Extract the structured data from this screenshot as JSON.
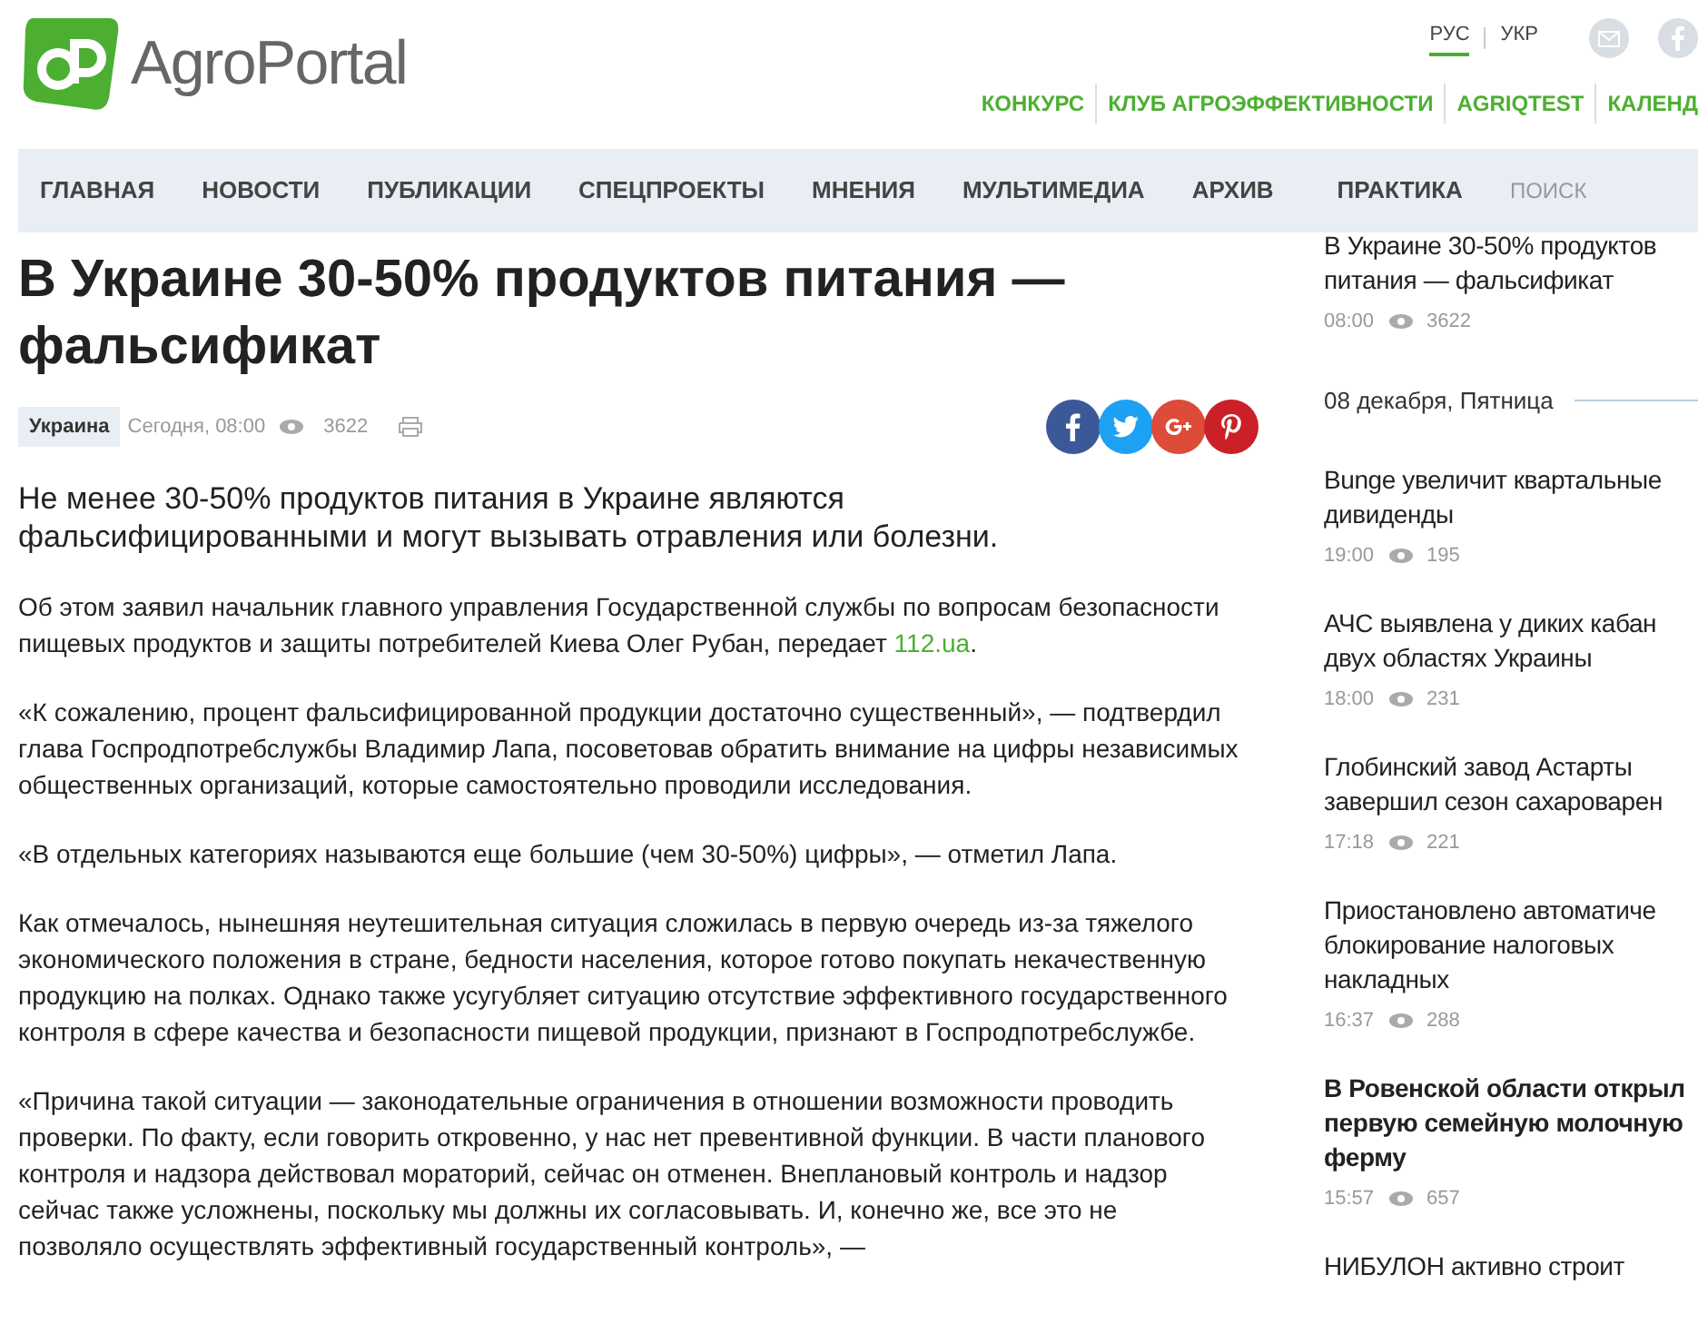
{
  "header": {
    "logo_text": "AgroPortal",
    "languages": [
      {
        "label": "РУС",
        "selected": true
      },
      {
        "label": "УКР",
        "selected": false
      }
    ],
    "top_links": [
      "КОНКУРС",
      "КЛУБ АГРОЭФФЕКТИВНОСТИ",
      "AGRIQTEST",
      "КАЛЕНД"
    ]
  },
  "nav": {
    "items": [
      "ГЛАВНАЯ",
      "НОВОСТИ",
      "ПУБЛИКАЦИИ",
      "СПЕЦПРОЕКТЫ",
      "МНЕНИЯ",
      "МУЛЬТИМЕДИА",
      "АРХИВ",
      "ПРАКТИКА"
    ],
    "search": {
      "placeholder": "ПОИСК"
    }
  },
  "article": {
    "title": "В Украине 30-50% продуктов питания — фальсификат",
    "tag": "Украина",
    "date": "Сегодня, 08:00",
    "views": "3622",
    "lead": "Не менее 30-50% продуктов питания в Украине являются фальсифицированными и могут вызывать отравления или болезни.",
    "paragraphs": [
      {
        "text": "Об этом заявил начальник главного управления Государственной службы по вопросам безопасности пищевых продуктов и защиты потребителей Киева Олег Рубан, передает ",
        "link": "112.ua",
        "after": "."
      },
      {
        "text": "«К сожалению, процент фальсифицированной продукции достаточно существенный», — подтвердил глава Госпродпотребслужбы Владимир Лапа, посоветовав обратить внимание на цифры независимых общественных организаций, которые самостоятельно проводили исследования."
      },
      {
        "text": "«В отдельных категориях называются еще большие (чем 30-50%) цифры», — отметил Лапа."
      },
      {
        "text": "Как отмечалось, нынешняя неутешительная ситуация сложилась в первую очередь из-за тяжелого экономического положения в стране, бедности населения, которое готово покупать некачественную продукцию на полках. Однако также усугубляет ситуацию отсутствие эффективного государственного контроля в сфере качества и безопасности пищевой продукции, признают в Госпродпотребслужбе."
      },
      {
        "text": "«Причина такой ситуации — законодательные ограничения в отношении возможности проводить проверки. По факту, если говорить откровенно, у нас нет превентивной функции. В части планового контроля и надзора действовал мораторий, сейчас он отменен. Внеплановый контроль и надзор сейчас также усложнены, поскольку мы должны их согласовывать. И, конечно же, все это не позволяло осуществлять эффективный государственный контроль», —"
      }
    ]
  },
  "sidebar": {
    "items": [
      {
        "kind": "news",
        "title": "В Украине 30-50% продуктов питания — фальсификат",
        "time": "08:00",
        "views": "3622",
        "bold": false
      },
      {
        "kind": "date",
        "title": "08 декабря, Пятница"
      },
      {
        "kind": "news",
        "title": "Bunge увеличит квартальные дивиденды",
        "time": "19:00",
        "views": "195",
        "bold": false
      },
      {
        "kind": "news",
        "title": "АЧС выявлена у диких кабан двух областях Украины",
        "time": "18:00",
        "views": "231",
        "bold": false
      },
      {
        "kind": "news",
        "title": "Глобинский завод Астарты завершил сезон сахароварен",
        "time": "17:18",
        "views": "221",
        "bold": false
      },
      {
        "kind": "news",
        "title": "Приостановлено автоматиче блокирование налоговых накладных",
        "time": "16:37",
        "views": "288",
        "bold": false
      },
      {
        "kind": "news",
        "title": "В Ровенской области открыл первую семейную молочную ферму",
        "time": "15:57",
        "views": "657",
        "bold": true
      },
      {
        "kind": "news",
        "title": "НИБУЛОН активно строит",
        "bold": false
      }
    ]
  }
}
